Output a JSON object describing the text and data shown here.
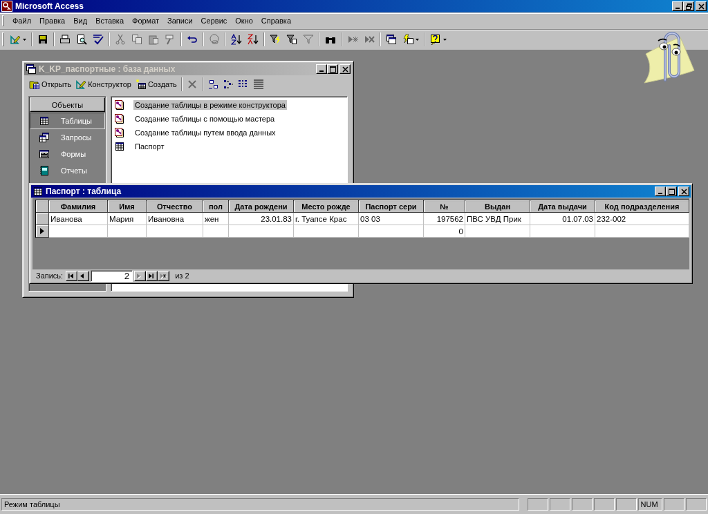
{
  "window": {
    "title": "Microsoft Access"
  },
  "menu": [
    "Файл",
    "Правка",
    "Вид",
    "Вставка",
    "Формат",
    "Записи",
    "Сервис",
    "Окно",
    "Справка"
  ],
  "toolbar": [
    {
      "kind": "design",
      "disabled": false,
      "dropdown": true
    },
    {
      "kind": "separator"
    },
    {
      "kind": "save",
      "disabled": false
    },
    {
      "kind": "separator"
    },
    {
      "kind": "print",
      "disabled": false
    },
    {
      "kind": "preview",
      "disabled": false
    },
    {
      "kind": "spelling",
      "disabled": false
    },
    {
      "kind": "separator"
    },
    {
      "kind": "cut",
      "disabled": true
    },
    {
      "kind": "copy",
      "disabled": true
    },
    {
      "kind": "paste",
      "disabled": true
    },
    {
      "kind": "painter",
      "disabled": true
    },
    {
      "kind": "separator"
    },
    {
      "kind": "undo",
      "disabled": false
    },
    {
      "kind": "separator"
    },
    {
      "kind": "hyperlink",
      "disabled": true
    },
    {
      "kind": "separator"
    },
    {
      "kind": "sort-asc",
      "disabled": false
    },
    {
      "kind": "sort-desc",
      "disabled": false
    },
    {
      "kind": "separator"
    },
    {
      "kind": "filter-selection",
      "disabled": false
    },
    {
      "kind": "filter-form",
      "disabled": false
    },
    {
      "kind": "apply-filter",
      "disabled": true
    },
    {
      "kind": "separator"
    },
    {
      "kind": "find",
      "disabled": false
    },
    {
      "kind": "separator"
    },
    {
      "kind": "new-record",
      "disabled": true
    },
    {
      "kind": "delete-record",
      "disabled": true
    },
    {
      "kind": "separator"
    },
    {
      "kind": "database",
      "disabled": false
    },
    {
      "kind": "new-object",
      "disabled": false,
      "dropdown": true
    },
    {
      "kind": "separator"
    },
    {
      "kind": "help",
      "disabled": false,
      "dropdown": true
    }
  ],
  "database_window": {
    "title": "K_KP_паспортные : база данных",
    "active": false,
    "toolbar": [
      {
        "kind": "open",
        "label": "Открыть",
        "disabled": false
      },
      {
        "kind": "design",
        "label": "Конструктор",
        "disabled": false
      },
      {
        "kind": "new",
        "label": "Создать",
        "disabled": false
      },
      {
        "kind": "separator"
      },
      {
        "kind": "delete",
        "disabled": true
      },
      {
        "kind": "separator"
      },
      {
        "kind": "large-icons",
        "disabled": false
      },
      {
        "kind": "small-icons",
        "disabled": false
      },
      {
        "kind": "list-view",
        "disabled": false
      },
      {
        "kind": "details-view",
        "disabled": false
      }
    ],
    "objects": {
      "header": "Объекты",
      "items": [
        {
          "label": "Таблицы",
          "kind": "tables",
          "selected": true
        },
        {
          "label": "Запросы",
          "kind": "queries",
          "selected": false
        },
        {
          "label": "Формы",
          "kind": "forms",
          "selected": false
        },
        {
          "label": "Отчеты",
          "kind": "reports",
          "selected": false
        }
      ]
    },
    "list": [
      {
        "label": "Создание таблицы в режиме конструктора",
        "kind": "wizard",
        "selected": true
      },
      {
        "label": "Создание таблицы с помощью мастера",
        "kind": "wizard",
        "selected": false
      },
      {
        "label": "Создание таблицы путем ввода данных",
        "kind": "wizard",
        "selected": false
      },
      {
        "label": "Паспорт",
        "kind": "table",
        "selected": false
      }
    ]
  },
  "table_window": {
    "title": "Паспорт : таблица",
    "active": true,
    "columns": [
      {
        "label": "Фамилия",
        "kind": "text"
      },
      {
        "label": "Имя",
        "kind": "text"
      },
      {
        "label": "Отчество",
        "kind": "text"
      },
      {
        "label": "пол",
        "kind": "text"
      },
      {
        "label": "Дата рождени",
        "kind": "date"
      },
      {
        "label": "Место рожде",
        "kind": "text"
      },
      {
        "label": "Паспорт сери",
        "kind": "text"
      },
      {
        "label": "№",
        "kind": "number"
      },
      {
        "label": "Выдан",
        "kind": "text"
      },
      {
        "label": "Дата выдачи",
        "kind": "date"
      },
      {
        "label": "Код подразделения",
        "kind": "text"
      }
    ],
    "rows": [
      {
        "current": false,
        "cells": [
          "Иванова",
          "Мария",
          "Ивановна",
          "жен",
          "23.01.83",
          "г. Туапсе Крас",
          "03 03",
          "197562",
          "ПВС УВД Прик",
          "01.07.03",
          "232-002"
        ]
      },
      {
        "current": true,
        "cells": [
          null,
          null,
          null,
          null,
          null,
          null,
          null,
          "0",
          null,
          null,
          null
        ]
      }
    ],
    "navigator": {
      "label": "Запись:",
      "value": "2",
      "total": "из 2",
      "buttons": [
        {
          "kind": "first",
          "disabled": false
        },
        {
          "kind": "prev",
          "disabled": false
        },
        {
          "kind": "next",
          "disabled": true
        },
        {
          "kind": "last",
          "disabled": false
        },
        {
          "kind": "new",
          "disabled": true
        }
      ]
    }
  },
  "status_bar": {
    "text": "Режим таблицы",
    "indicators": [
      "NUM"
    ]
  }
}
